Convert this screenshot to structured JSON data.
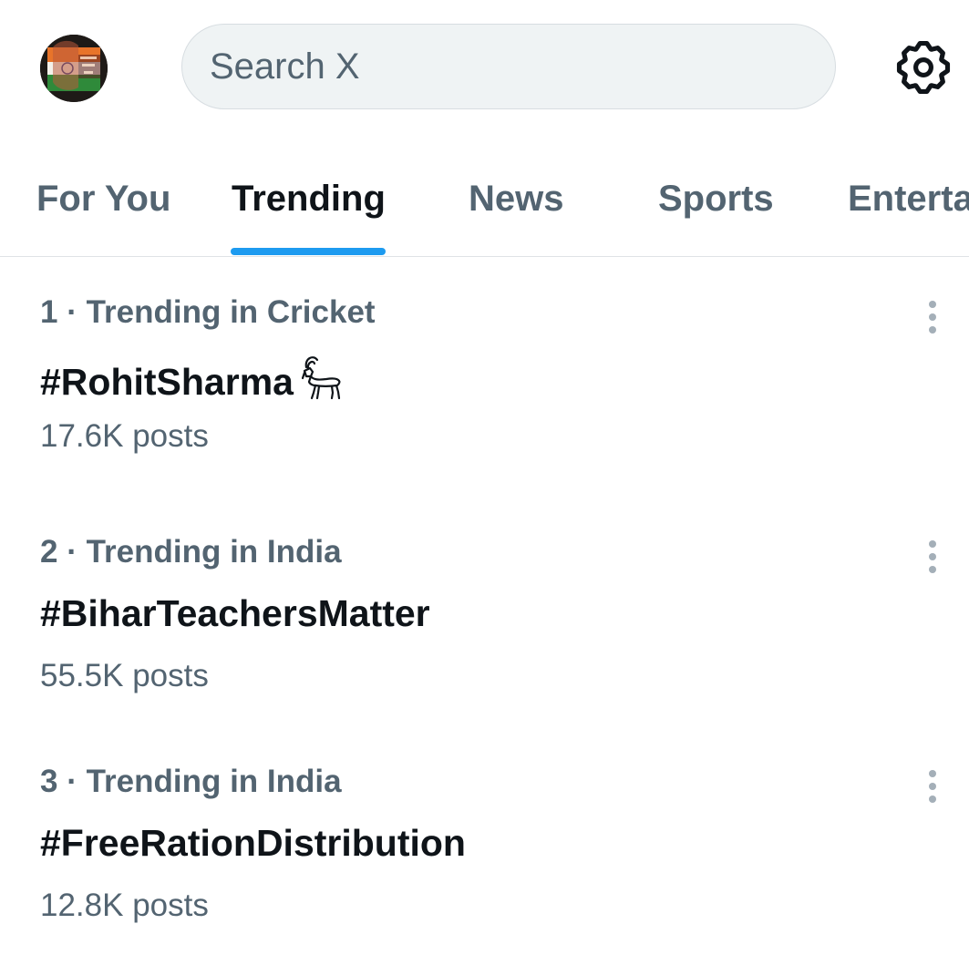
{
  "search": {
    "placeholder": "Search X"
  },
  "tabs": [
    {
      "label": "For You",
      "active": false
    },
    {
      "label": "Trending",
      "active": true
    },
    {
      "label": "News",
      "active": false
    },
    {
      "label": "Sports",
      "active": false
    },
    {
      "label": "Entertainment",
      "active": false
    }
  ],
  "trends": [
    {
      "meta": "1 · Trending in Cricket",
      "name": "#RohitSharma",
      "emoji_icon": "goat-emoji-icon",
      "posts": "17.6K posts"
    },
    {
      "meta": "2 · Trending in India",
      "name": "#BiharTeachersMatter",
      "posts": "55.5K posts"
    },
    {
      "meta": "3 · Trending in India",
      "name": "#FreeRationDistribution",
      "posts": "12.8K posts"
    }
  ],
  "colors": {
    "accent": "#1d9bf0",
    "text_primary": "#0f1419",
    "text_secondary": "#536471",
    "search_bg": "#eff3f4"
  },
  "icons": {
    "avatar": "avatar-image",
    "settings": "gear-icon",
    "more": "more-vertical-icon"
  }
}
